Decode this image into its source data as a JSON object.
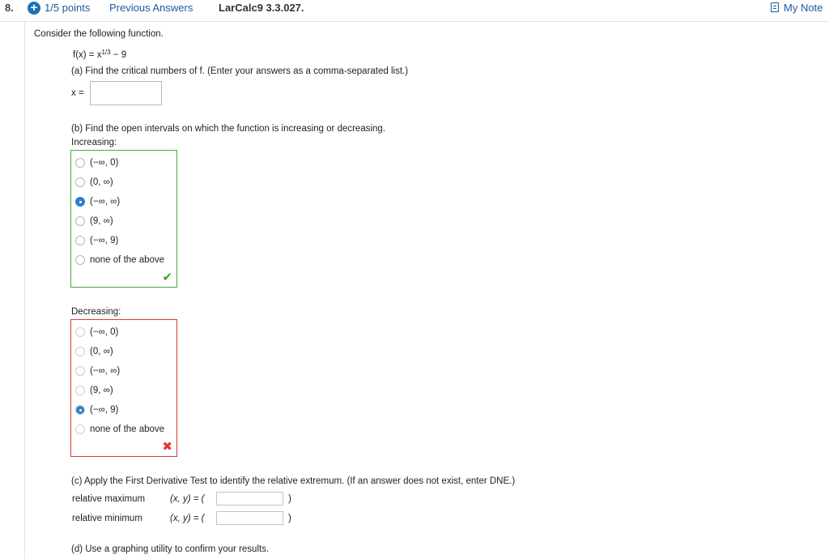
{
  "header": {
    "question_number": "8.",
    "points": "1/5 points",
    "previous_answers": "Previous Answers",
    "question_id": "LarCalc9 3.3.027.",
    "my_notes": "My Note"
  },
  "problem": {
    "intro": "Consider the following function.",
    "function_lhs": "f(x) = x",
    "function_exp": "1/3",
    "function_rhs": " − 9",
    "part_a": "(a) Find the critical numbers of f. (Enter your answers as a comma-separated list.)",
    "part_a_label": "x =",
    "part_a_value": "",
    "part_b": "(b) Find the open intervals on which the function is increasing or decreasing.",
    "increasing_label": "Increasing:",
    "increasing_options": [
      "(−∞, 0)",
      "(0, ∞)",
      "(−∞, ∞)",
      "(9, ∞)",
      "(−∞, 9)",
      "none of the above"
    ],
    "increasing_selected_index": 2,
    "increasing_result": "correct",
    "decreasing_label": "Decreasing:",
    "decreasing_options": [
      "(−∞, 0)",
      "(0, ∞)",
      "(−∞, ∞)",
      "(9, ∞)",
      "(−∞, 9)",
      "none of the above"
    ],
    "decreasing_selected_index": 4,
    "decreasing_result": "incorrect",
    "part_c": "(c) Apply the First Derivative Test to identify the relative extremum. (If an answer does not exist, enter DNE.)",
    "relative_maximum_label": "relative maximum",
    "relative_minimum_label": "relative minimum",
    "xy_label": "(x, y) = (",
    "close_paren": ")",
    "relative_maximum_value": "",
    "relative_minimum_value": "",
    "part_d": "(d) Use a graphing utility to confirm your results."
  },
  "icons": {
    "plus": "plus-circle-icon",
    "notes": "notes-icon",
    "check": "checkmark-icon",
    "cross": "cross-icon"
  },
  "colors": {
    "link": "#1d5a9c",
    "correct": "#49a942",
    "incorrect": "#d83a3a",
    "radio_selected": "#2c7fd0"
  }
}
